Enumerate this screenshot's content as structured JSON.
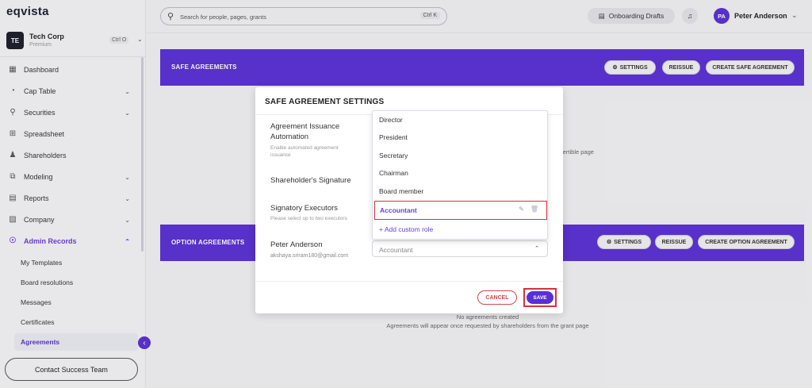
{
  "app": {
    "logo": "eqvista"
  },
  "company": {
    "initials": "TE",
    "name": "Tech Corp",
    "plan": "Premium",
    "shortcut": "Ctrl O"
  },
  "sidebar": {
    "items": [
      {
        "label": "Dashboard",
        "icon": "dashboard-icon",
        "has_caret": false
      },
      {
        "label": "Cap Table",
        "icon": "pie-chart-icon",
        "has_caret": true
      },
      {
        "label": "Securities",
        "icon": "securities-icon",
        "has_caret": true
      },
      {
        "label": "Spreadsheet",
        "icon": "spreadsheet-icon",
        "has_caret": false
      },
      {
        "label": "Shareholders",
        "icon": "shareholders-icon",
        "has_caret": false
      },
      {
        "label": "Modeling",
        "icon": "modeling-icon",
        "has_caret": true
      },
      {
        "label": "Reports",
        "icon": "reports-icon",
        "has_caret": true
      },
      {
        "label": "Company",
        "icon": "company-icon",
        "has_caret": true
      },
      {
        "label": "Admin Records",
        "icon": "admin-records-icon",
        "has_caret": true,
        "active": true
      }
    ],
    "sub_items": [
      "My Templates",
      "Board resolutions",
      "Messages",
      "Certificates",
      "Agreements"
    ],
    "active_sub": "Agreements",
    "contact": "Contact Success Team"
  },
  "topbar": {
    "search_placeholder": "Search for people, pages, grants",
    "search_shortcut": "Ctrl K",
    "drafts": "Onboarding Drafts",
    "user_initials": "PA",
    "user_name": "Peter Anderson"
  },
  "safe_section": {
    "title": "SAFE AGREEMENTS",
    "settings": "SETTINGS",
    "reissue": "REISSUE",
    "create": "CREATE SAFE AGREEMENT",
    "partial_text": "vertible page"
  },
  "option_section": {
    "title": "OPTION AGREEMENTS",
    "settings": "SETTINGS",
    "reissue": "REISSUE",
    "create": "CREATE OPTION AGREEMENT",
    "empty_title": "No agreements created",
    "empty_sub": "Agreements will appear once requested by shareholders from the grant page"
  },
  "modal": {
    "title": "SAFE AGREEMENT SETTINGS",
    "automation_label": "Agreement Issuance Automation",
    "automation_sub": "Enable automated agreement issuance",
    "signature_label": "Shareholder's Signature",
    "executors_label": "Signatory Executors",
    "executors_sub": "Please select up to two executors",
    "executor_name": "Peter Anderson",
    "executor_email": "akshaya.sriram180@gmail.com",
    "executor_role": "Accountant",
    "cancel": "CANCEL",
    "save": "SAVE"
  },
  "dropdown": {
    "options": [
      "Director",
      "President",
      "Secretary",
      "Chairman",
      "Board member",
      "Accountant"
    ],
    "selected": "Accountant",
    "add_custom": "+ Add custom role"
  },
  "colors": {
    "accent": "#5b2fd6",
    "highlight": "#d6323c"
  }
}
